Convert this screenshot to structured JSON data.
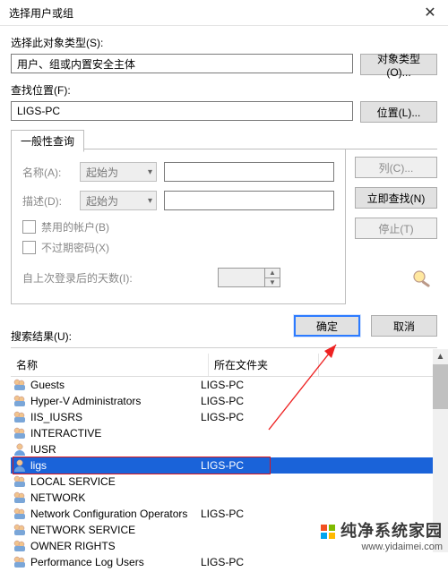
{
  "title": "选择用户或组",
  "obj_type_label": "选择此对象类型(S):",
  "obj_type_value": "用户、组或内置安全主体",
  "obj_type_btn": "对象类型(O)...",
  "loc_label": "查找位置(F):",
  "loc_value": "LIGS-PC",
  "loc_btn": "位置(L)...",
  "tab_label": "一般性查询",
  "name_label": "名称(A):",
  "desc_label": "描述(D):",
  "combo_text": "起始为",
  "btn_columns": "列(C)...",
  "btn_findnow": "立即查找(N)",
  "btn_stop": "停止(T)",
  "chk_disabled": "禁用的帐户(B)",
  "chk_noexpire": "不过期密码(X)",
  "days_label": "自上次登录后的天数(I):",
  "btn_ok": "确定",
  "btn_cancel": "取消",
  "results_label": "搜索结果(U):",
  "hdr_name": "名称",
  "hdr_folder": "所在文件夹",
  "rows": [
    {
      "name": "Guests",
      "folder": "LIGS-PC"
    },
    {
      "name": "Hyper-V Administrators",
      "folder": "LIGS-PC"
    },
    {
      "name": "IIS_IUSRS",
      "folder": "LIGS-PC"
    },
    {
      "name": "INTERACTIVE",
      "folder": ""
    },
    {
      "name": "IUSR",
      "folder": ""
    },
    {
      "name": "ligs",
      "folder": "LIGS-PC"
    },
    {
      "name": "LOCAL SERVICE",
      "folder": ""
    },
    {
      "name": "NETWORK",
      "folder": ""
    },
    {
      "name": "Network Configuration Operators",
      "folder": "LIGS-PC"
    },
    {
      "name": "NETWORK SERVICE",
      "folder": ""
    },
    {
      "name": "OWNER RIGHTS",
      "folder": ""
    },
    {
      "name": "Performance Log Users",
      "folder": "LIGS-PC"
    }
  ],
  "selected_index": 5,
  "watermark_line1": "纯净系统家园",
  "watermark_line2": "www.yidaimei.com"
}
